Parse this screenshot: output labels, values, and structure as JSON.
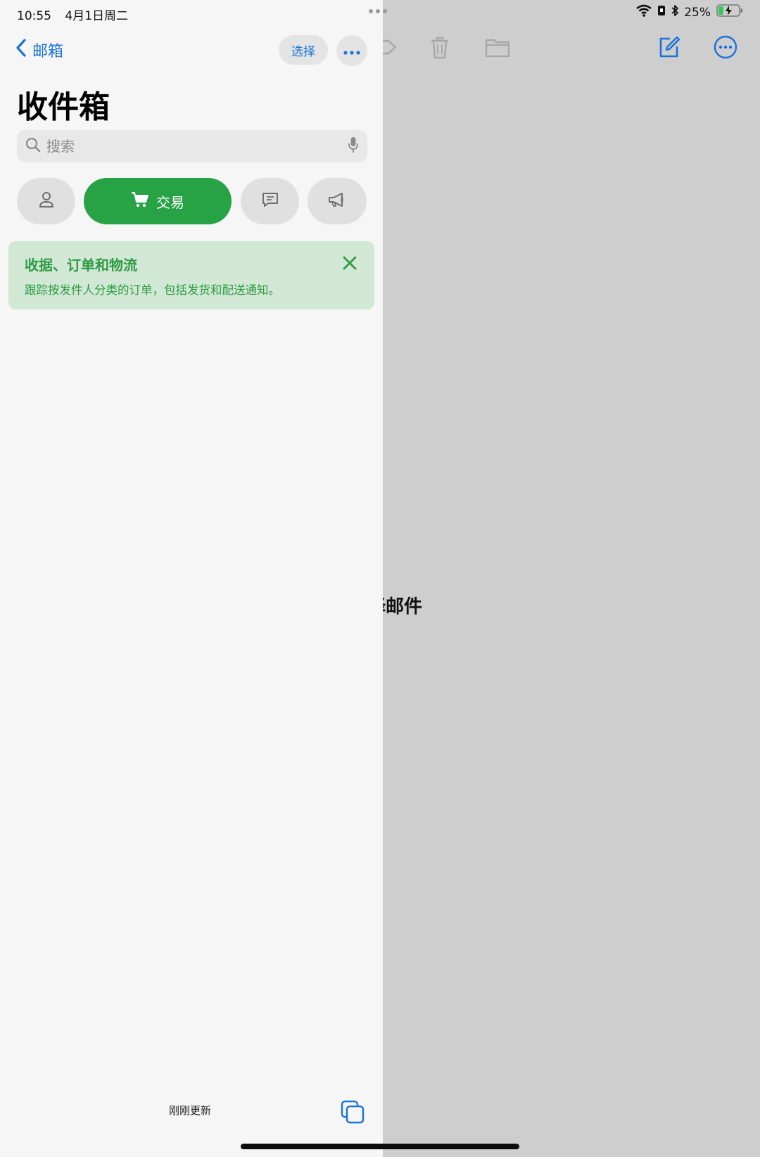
{
  "status_bar": {
    "time": "10:55",
    "date": "4月1日周二",
    "battery_percent": "25%",
    "battery_level": 0.25
  },
  "nav": {
    "back_label": "邮箱",
    "select_label": "选择"
  },
  "page_title": "收件箱",
  "search": {
    "placeholder": "搜索"
  },
  "categories": {
    "active_label": "交易",
    "items": [
      {
        "icon": "person-icon",
        "label": ""
      },
      {
        "icon": "cart-icon",
        "label": "交易"
      },
      {
        "icon": "message-icon",
        "label": ""
      },
      {
        "icon": "megaphone-icon",
        "label": ""
      }
    ]
  },
  "banner": {
    "title": "收据、订单和物流",
    "text": "跟踪按发件人分类的订单，包括发货和配送通知。"
  },
  "footer": {
    "updated_text": "刚刚更新"
  },
  "detail": {
    "placeholder": "未选择邮件"
  },
  "colors": {
    "accent_blue": "#1a73d9",
    "transaction_green": "#27a244",
    "banner_bg": "#d1e8d4",
    "banner_text": "#2f9b46",
    "detail_bg": "#cecece",
    "sidebar_bg": "#f6f6f6"
  }
}
